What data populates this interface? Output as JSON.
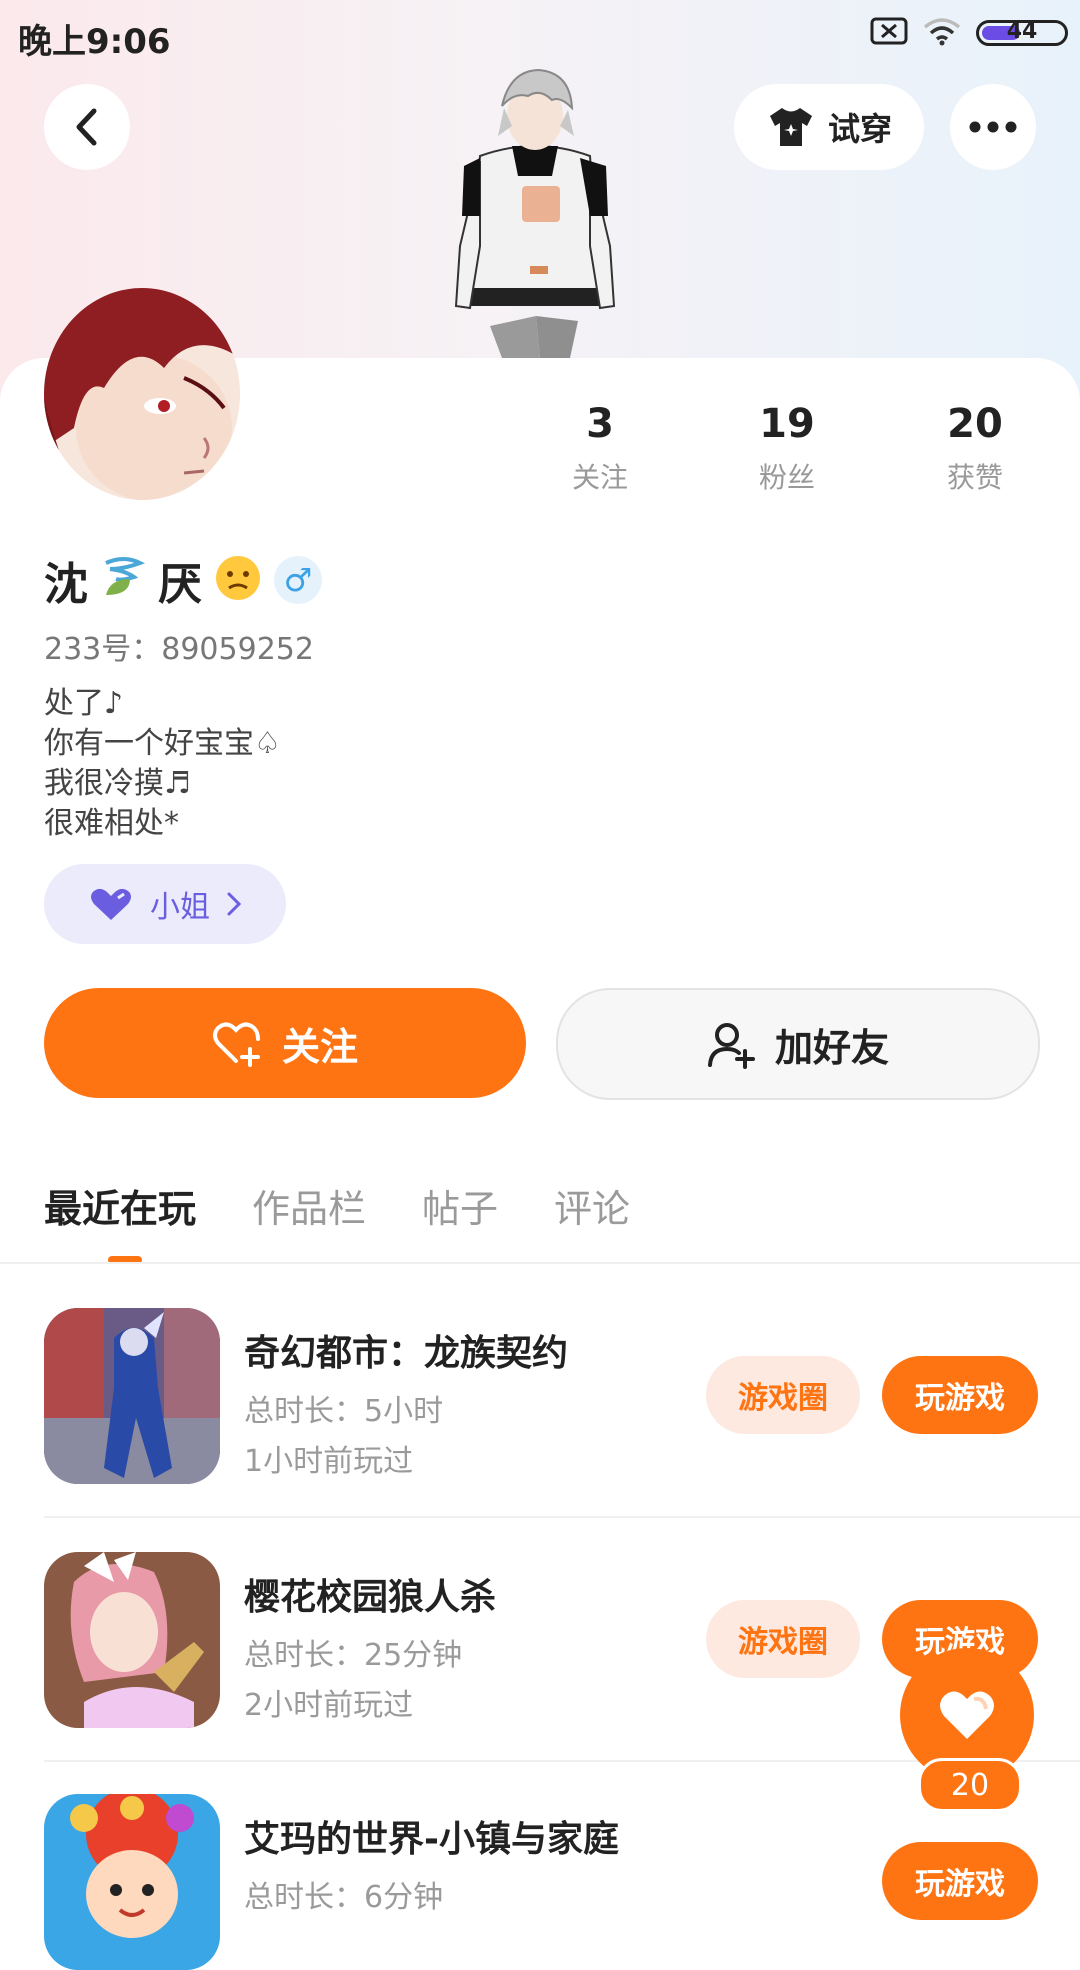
{
  "status_bar": {
    "time": "晚上9:06",
    "battery_level": "44",
    "battery_fraction": 0.44
  },
  "header": {
    "tryon_label": "试穿"
  },
  "profile": {
    "name": "沈",
    "name_part2": "厌",
    "gender": "♂",
    "uid": "233号：89059252",
    "bio": [
      "处了♪",
      "你有一个好宝宝♤",
      "我很冷摸♬",
      "很难相处*"
    ],
    "tag_label": "小姐"
  },
  "stats": [
    {
      "value": "3",
      "label": "关注"
    },
    {
      "value": "19",
      "label": "粉丝"
    },
    {
      "value": "20",
      "label": "获赞"
    }
  ],
  "actions": {
    "follow_label": "关注",
    "add_friend_label": "加好友"
  },
  "tabs": [
    {
      "label": "最近在玩",
      "active": true
    },
    {
      "label": "作品栏",
      "active": false
    },
    {
      "label": "帖子",
      "active": false
    },
    {
      "label": "评论",
      "active": false
    }
  ],
  "games": [
    {
      "title": "奇幻都市：龙族契约",
      "duration": "总时长：5小时",
      "last_played": "1小时前玩过",
      "circle_label": "游戏圈",
      "play_label": "玩游戏"
    },
    {
      "title": "樱花校园狼人杀",
      "duration": "总时长：25分钟",
      "last_played": "2小时前玩过",
      "circle_label": "游戏圈",
      "play_label": "玩游戏"
    },
    {
      "title": "艾玛的世界-小镇与家庭",
      "duration": "总时长：6分钟",
      "last_played": "",
      "circle_label": "",
      "play_label": "玩游戏"
    }
  ],
  "floating_like": {
    "count": "20"
  },
  "colors": {
    "accent": "#ff7412",
    "tag_bg": "#ecebfb",
    "tag_fg": "#6a5de0"
  }
}
